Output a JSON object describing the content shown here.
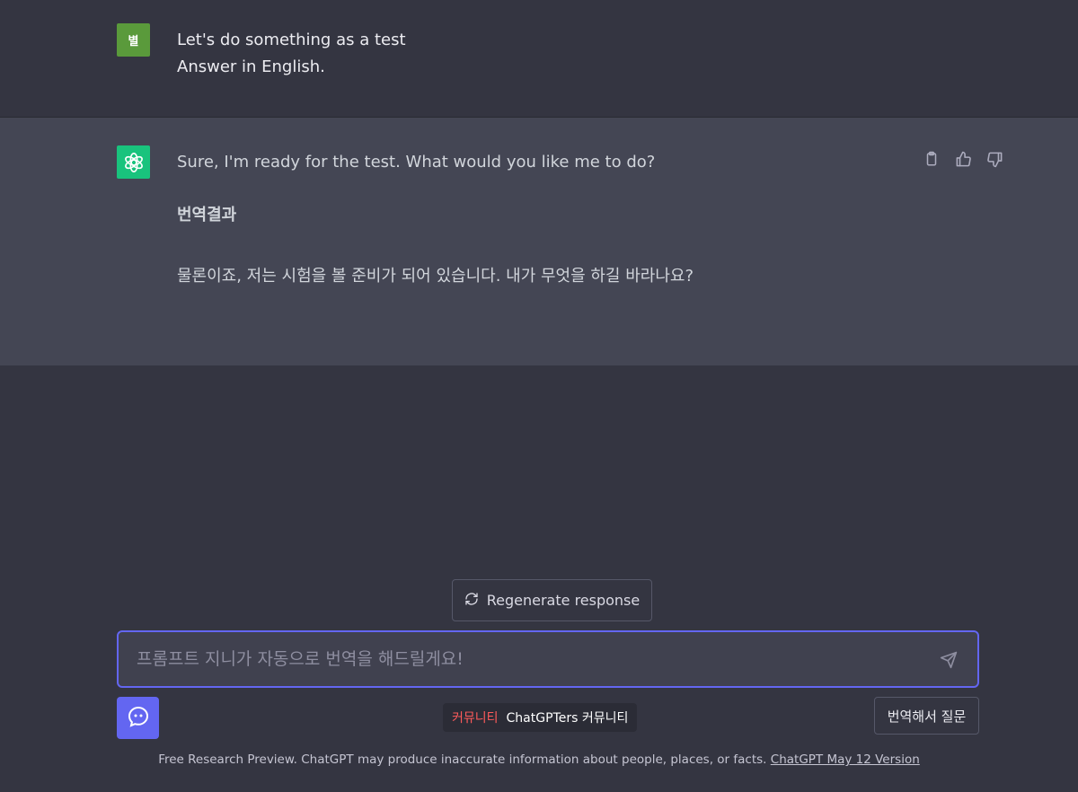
{
  "user_message": {
    "avatar_text": "별",
    "line1": "Let's do something as a test",
    "line2": "Answer in English."
  },
  "assistant_message": {
    "avatar_icon": "openai-logo-icon",
    "answer": "Sure, I'm ready for the test. What would you like me to do?",
    "heading": "번역결과",
    "translation": "물론이죠, 저는 시험을 볼 준비가 되어 있습니다. 내가 무엇을 하길 바라나요?",
    "actions": [
      "copy-icon",
      "thumbs-up-icon",
      "thumbs-down-icon"
    ]
  },
  "regenerate": {
    "label": "Regenerate response",
    "icon": "refresh-icon"
  },
  "prompt": {
    "placeholder": "프롬프트 지니가 자동으로 번역을 해드릴게요!",
    "value": "",
    "send_icon": "send-icon"
  },
  "genie_button": {
    "icon": "genie-face-icon"
  },
  "community": {
    "tag": "커뮤니티",
    "name": "ChatGPTers 커뮤니티"
  },
  "translate_button": {
    "label": "번역해서 질문"
  },
  "footer": {
    "text": "Free Research Preview. ChatGPT may produce inaccurate information about people, places, or facts.",
    "link": "ChatGPT May 12 Version"
  },
  "colors": {
    "background": "#343541",
    "assistant_bg": "#444654",
    "user_avatar": "#5a9a3b",
    "gpt_avatar": "#19c37d",
    "accent": "#6366f1",
    "community_tag": "#ff5b5b"
  }
}
